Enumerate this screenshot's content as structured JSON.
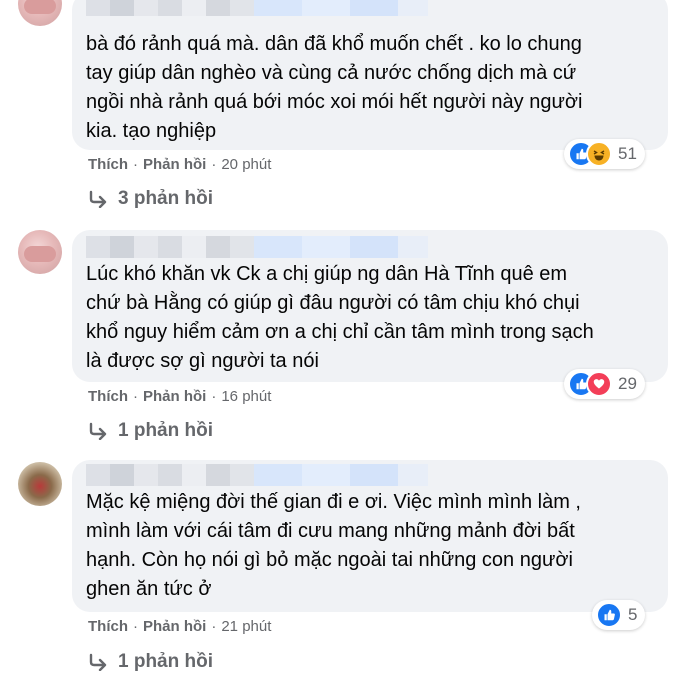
{
  "comments": [
    {
      "text": "bà đó rảnh quá mà. dân đã khổ muốn chết . ko lo chung\ntay giúp dân nghèo và cùng cả nước chống dịch mà cứ\nngồi nhà rảnh quá bới móc xoi mói hết người này người\nkia. tạo nghiệp",
      "like_label": "Thích",
      "reply_label": "Phản hồi",
      "time": "20 phút",
      "reaction_count": "51",
      "reactions": [
        "like-icon",
        "haha-icon"
      ],
      "replies_label": "3 phản hồi"
    },
    {
      "text": "Lúc khó khăn vk Ck a chị giúp ng dân Hà Tĩnh quê em\nchứ bà Hằng có giúp gì đâu người có tâm chịu khó chụi\nkhổ nguy hiểm cảm ơn a chị chỉ cần tâm mình trong sạch\nlà được sợ gì người ta nói",
      "like_label": "Thích",
      "reply_label": "Phản hồi",
      "time": "16 phút",
      "reaction_count": "29",
      "reactions": [
        "like-icon",
        "love-icon"
      ],
      "replies_label": "1 phản hồi"
    },
    {
      "text": "Mặc kệ miệng đời thế gian đi e ơi. Việc mình mình làm ,\nmình làm với cái tâm đi cưu mang những mảnh đời bất\nhạnh. Còn họ nói gì bỏ mặc ngoài tai những con người\nghen ăn tức ở",
      "like_label": "Thích",
      "reply_label": "Phản hồi",
      "time": "21 phút",
      "reaction_count": "5",
      "reactions": [
        "like-icon"
      ],
      "replies_label": "1 phản hồi"
    }
  ],
  "colors": {
    "bubble": "#f0f2f5",
    "secondary_text": "#65676b",
    "like": "#1877f2",
    "haha": "#f7b125",
    "love": "#f33e58"
  }
}
